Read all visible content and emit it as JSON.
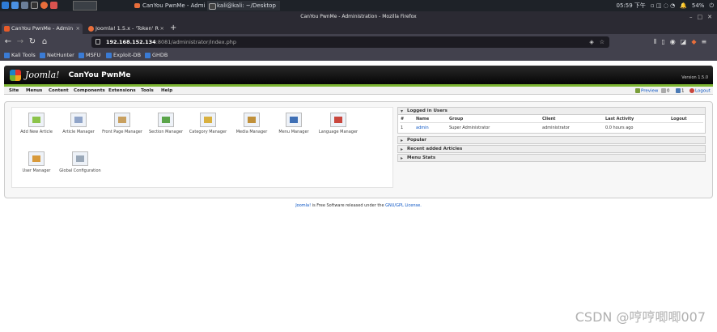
{
  "taskbar": {
    "tasks": [
      {
        "label": "CanYou PwnMe - Admin..."
      },
      {
        "label": "kali@kali: ~/Desktop"
      }
    ],
    "clock": "05:59 下午",
    "battery": "54%"
  },
  "browser": {
    "window_title": "CanYou PwnMe - Administration - Mozilla Firefox",
    "tabs": [
      {
        "label": "CanYou PwnMe - Admin",
        "active": true
      },
      {
        "label": "Joomla! 1.5.x - 'Token' R",
        "active": false
      }
    ],
    "new_tab": "+",
    "url_host": "192.168.152.134",
    "url_path": ":8081/administrator/index.php",
    "bookmarks": [
      "Kali Tools",
      "NetHunter",
      "MSFU",
      "Exploit-DB",
      "GHDB"
    ]
  },
  "joomla": {
    "logo_text": "Joomla!",
    "site_name": "CanYou PwnMe",
    "version": "Version 1.5.0",
    "menu": [
      "Site",
      "Menus",
      "Content",
      "Components",
      "Extensions",
      "Tools",
      "Help"
    ],
    "right_bar": {
      "preview": "Preview",
      "messages": "0",
      "users": "1",
      "logout": "Logout"
    },
    "icons": [
      {
        "label": "Add New Article",
        "icon": "add-article-icon",
        "color": "#8bc34a"
      },
      {
        "label": "Article Manager",
        "icon": "article-manager-icon",
        "color": "#90a4c8"
      },
      {
        "label": "Front Page Manager",
        "icon": "frontpage-icon",
        "color": "#c8a060"
      },
      {
        "label": "Section Manager",
        "icon": "section-manager-icon",
        "color": "#5aa44a"
      },
      {
        "label": "Category Manager",
        "icon": "category-manager-icon",
        "color": "#d8b040"
      },
      {
        "label": "Media Manager",
        "icon": "media-manager-icon",
        "color": "#c0903a"
      },
      {
        "label": "Menu Manager",
        "icon": "menu-manager-icon",
        "color": "#3e6fb5"
      },
      {
        "label": "Language Manager",
        "icon": "language-manager-icon",
        "color": "#c9463d"
      },
      {
        "label": "User Manager",
        "icon": "user-manager-icon",
        "color": "#d89a3c"
      },
      {
        "label": "Global Configuration",
        "icon": "global-config-icon",
        "color": "#9aa8b8"
      }
    ],
    "panels": {
      "logged_in": "Logged in Users",
      "popular": "Popular",
      "recent": "Recent added Articles",
      "menu_stats": "Menu Stats"
    },
    "logged_table": {
      "headers": [
        "#",
        "Name",
        "Group",
        "Client",
        "Last Activity",
        "Logout"
      ],
      "rows": [
        {
          "num": "1",
          "name": "admin",
          "group": "Super Administrator",
          "client": "administrator",
          "activity": "0.0 hours ago"
        }
      ]
    },
    "footer_link": "Joomla!",
    "footer_text": " is Free Software released under the ",
    "footer_license": "GNU/GPL License."
  },
  "watermark": "CSDN @哼哼唧唧007"
}
